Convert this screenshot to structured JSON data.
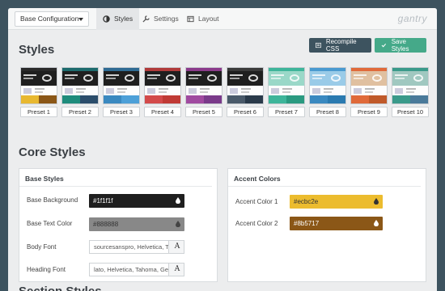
{
  "config_select": {
    "value": "Base Configuration"
  },
  "tabs": [
    {
      "label": "Styles",
      "icon": "adjust-icon",
      "active": true
    },
    {
      "label": "Settings",
      "icon": "wrench-icon",
      "active": false
    },
    {
      "label": "Layout",
      "icon": "layout-icon",
      "active": false
    }
  ],
  "logo": "gantry",
  "styles_heading": "Styles",
  "buttons": {
    "recompile": "Recompile CSS",
    "save": "Save Styles"
  },
  "presets": [
    {
      "label": "Preset 1",
      "bar": "#2a2a2a",
      "hero": "#1f1f1f",
      "a": "#e8b830",
      "b": "#8b5717"
    },
    {
      "label": "Preset 2",
      "bar": "#1d6b6d",
      "hero": "#1f1f1f",
      "a": "#1e8c7c",
      "b": "#2b4d6b"
    },
    {
      "label": "Preset 3",
      "bar": "#2f6b93",
      "hero": "#1f1f1f",
      "a": "#3a89c0",
      "b": "#4da0d8"
    },
    {
      "label": "Preset 4",
      "bar": "#b03a3a",
      "hero": "#1f1f1f",
      "a": "#d34a4a",
      "b": "#c03a35"
    },
    {
      "label": "Preset 5",
      "bar": "#8b3a8b",
      "hero": "#1f1f1f",
      "a": "#a04aa0",
      "b": "#7a3a8a"
    },
    {
      "label": "Preset 6",
      "bar": "#3a3a3a",
      "hero": "#1f1f1f",
      "a": "#4a5a6a",
      "b": "#2a3a4a"
    },
    {
      "label": "Preset 7",
      "bar": "#3eb59a",
      "hero": "#9ad8c8",
      "a": "#3eb59a",
      "b": "#2a9a80"
    },
    {
      "label": "Preset 8",
      "bar": "#4a9ad0",
      "hero": "#9acbe8",
      "a": "#3a89c0",
      "b": "#2a7ab0"
    },
    {
      "label": "Preset 9",
      "bar": "#e06a3a",
      "hero": "#e0c0a0",
      "a": "#e06a3a",
      "b": "#c05a2a"
    },
    {
      "label": "Preset 10",
      "bar": "#3a9a8a",
      "hero": "#a0c8c0",
      "a": "#3a9a8a",
      "b": "#4a7a9a"
    }
  ],
  "core_heading": "Core Styles",
  "base_styles": {
    "title": "Base Styles",
    "background_label": "Base Background",
    "background_value": "#1f1f1f",
    "text_color_label": "Base Text Color",
    "text_color_value": "#888888",
    "body_font_label": "Body Font",
    "body_font_value": "sourcesanspro, Helvetica, Tahoma",
    "heading_font_label": "Heading Font",
    "heading_font_value": "lato, Helvetica, Tahoma, Geneva",
    "font_button": "A"
  },
  "accent_colors": {
    "title": "Accent Colors",
    "accent1_label": "Accent Color 1",
    "accent1_value": "#ecbc2e",
    "accent2_label": "Accent Color 2",
    "accent2_value": "#8b5717"
  },
  "section_heading": "Section Styles"
}
